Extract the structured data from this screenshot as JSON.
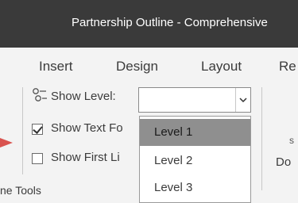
{
  "window": {
    "title": "Partnership Outline - Comprehensive"
  },
  "tabs": [
    {
      "label": "Insert"
    },
    {
      "label": "Design"
    },
    {
      "label": "Layout"
    },
    {
      "label": "Re"
    }
  ],
  "outline_tools": {
    "show_level_label": "Show Level:",
    "show_level_value": "",
    "show_text_formatting_label": "Show Text Fo",
    "show_text_formatting_checked": true,
    "show_first_line_label": "Show First Li",
    "show_first_line_checked": false,
    "group_label": "ne Tools",
    "level_options": [
      "Level 1",
      "Level 2",
      "Level 3"
    ],
    "highlighted_option": "Level 1"
  },
  "right_group": {
    "label": "Do",
    "small": "s"
  },
  "colors": {
    "titlebar": "#3a3a3a",
    "ribbon": "#f3f3f3",
    "highlight": "#8f8f8f",
    "pointer": "#d9534f"
  }
}
